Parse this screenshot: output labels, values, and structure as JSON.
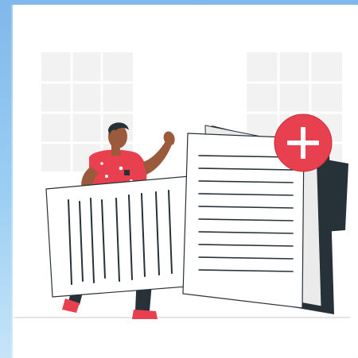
{
  "illustration": {
    "icons": {
      "add": "plus-icon",
      "document": "document-icon"
    },
    "colors": {
      "background": "#8fc3ee",
      "card": "#ffffff",
      "accent_red": "#e8404f",
      "shirt_red": "#e8404f",
      "dark": "#263238",
      "grid": "#f1f1f1",
      "paper": "#ffffff",
      "paper_back": "#ebebeb"
    }
  }
}
